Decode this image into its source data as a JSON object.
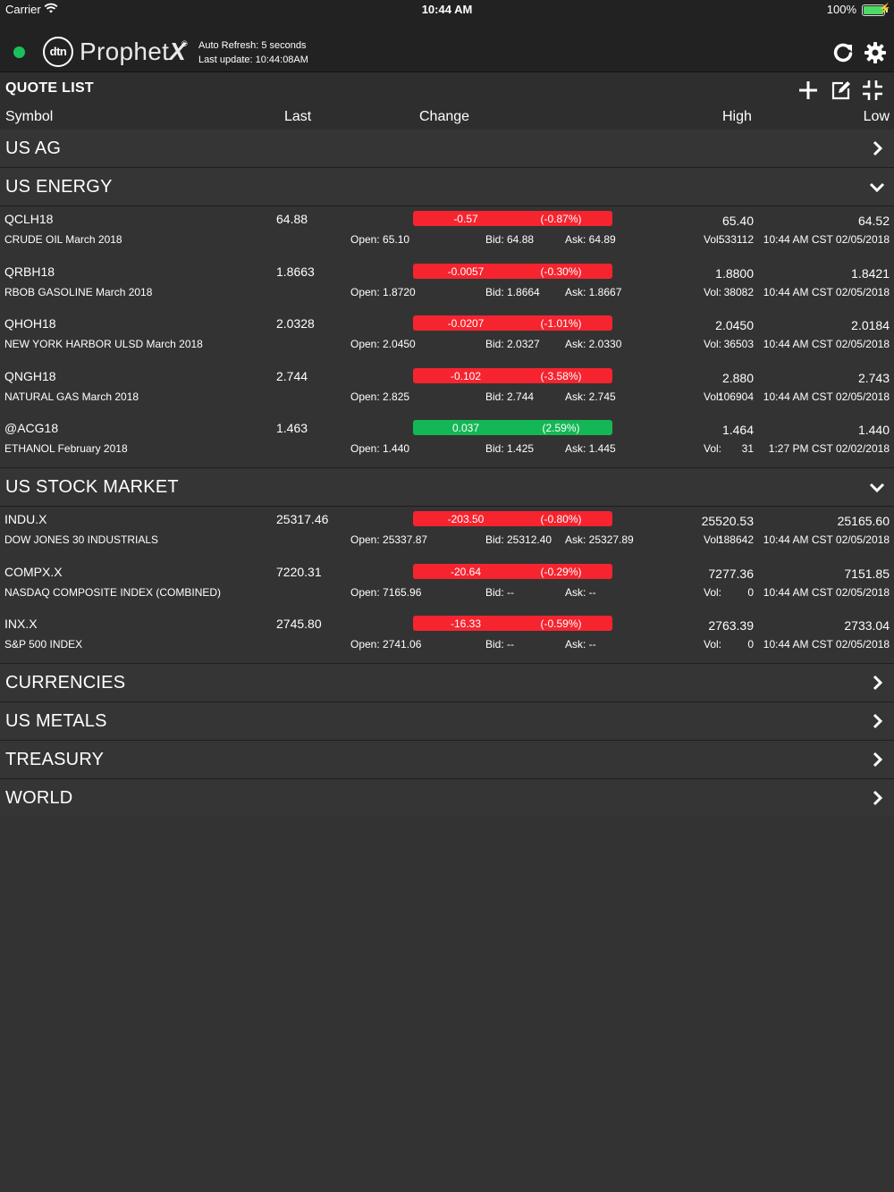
{
  "status_bar": {
    "carrier": "Carrier",
    "time": "10:44 AM",
    "battery": "100%"
  },
  "header": {
    "logo_mark": "dtn",
    "logo_word": "Prophet",
    "logo_x": "X",
    "logo_reg": "®",
    "auto_refresh": "Auto Refresh: 5 seconds",
    "last_update": "Last update: 10:44:08AM",
    "status_color": "#19c15a"
  },
  "quote_list": {
    "title": "QUOTE LIST",
    "columns": {
      "symbol": "Symbol",
      "last": "Last",
      "change": "Change",
      "high": "High",
      "low": "Low"
    }
  },
  "colors": {
    "negative": "#f5242f",
    "positive": "#14b755",
    "background": "#333333"
  },
  "groups": [
    {
      "name": "US AG",
      "expanded": false
    },
    {
      "name": "US ENERGY",
      "expanded": true
    },
    {
      "name": "US STOCK MARKET",
      "expanded": true
    },
    {
      "name": "CURRENCIES",
      "expanded": false
    },
    {
      "name": "US METALS",
      "expanded": false
    },
    {
      "name": "TREASURY",
      "expanded": false
    },
    {
      "name": "WORLD",
      "expanded": false
    }
  ],
  "energy_rows": [
    {
      "symbol": "QCLH18",
      "desc": "CRUDE OIL March 2018",
      "last": "64.88",
      "change": "-0.57",
      "pct": "(-0.87%)",
      "dir": "neg",
      "open": "Open: 65.10",
      "bid": "Bid: 64.88",
      "ask": "Ask: 64.89",
      "high": "65.40",
      "low": "64.52",
      "vol_label": "Vol:",
      "vol": "533112",
      "ts": "10:44 AM CST 02/05/2018"
    },
    {
      "symbol": "QRBH18",
      "desc": "RBOB GASOLINE March 2018",
      "last": "1.8663",
      "change": "-0.0057",
      "pct": "(-0.30%)",
      "dir": "neg",
      "open": "Open: 1.8720",
      "bid": "Bid: 1.8664",
      "ask": "Ask: 1.8667",
      "high": "1.8800",
      "low": "1.8421",
      "vol_label": "Vol:",
      "vol": "38082",
      "ts": "10:44 AM CST 02/05/2018"
    },
    {
      "symbol": "QHOH18",
      "desc": "NEW YORK HARBOR ULSD March 2018",
      "last": "2.0328",
      "change": "-0.0207",
      "pct": "(-1.01%)",
      "dir": "neg",
      "open": "Open: 2.0450",
      "bid": "Bid: 2.0327",
      "ask": "Ask: 2.0330",
      "high": "2.0450",
      "low": "2.0184",
      "vol_label": "Vol:",
      "vol": "36503",
      "ts": "10:44 AM CST 02/05/2018"
    },
    {
      "symbol": "QNGH18",
      "desc": "NATURAL GAS March 2018",
      "last": "2.744",
      "change": "-0.102",
      "pct": "(-3.58%)",
      "dir": "neg",
      "open": "Open: 2.825",
      "bid": "Bid: 2.744",
      "ask": "Ask: 2.745",
      "high": "2.880",
      "low": "2.743",
      "vol_label": "Vol:",
      "vol": "106904",
      "ts": "10:44 AM CST 02/05/2018"
    },
    {
      "symbol": "@ACG18",
      "desc": "ETHANOL February 2018",
      "last": "1.463",
      "change": "0.037",
      "pct": "(2.59%)",
      "dir": "pos",
      "open": "Open: 1.440",
      "bid": "Bid: 1.425",
      "ask": "Ask: 1.445",
      "high": "1.464",
      "low": "1.440",
      "vol_label": "Vol:",
      "vol": "31",
      "ts": "1:27 PM CST 02/02/2018"
    }
  ],
  "stock_rows": [
    {
      "symbol": "INDU.X",
      "desc": "DOW JONES 30 INDUSTRIALS",
      "last": "25317.46",
      "change": "-203.50",
      "pct": "(-0.80%)",
      "dir": "neg",
      "open": "Open: 25337.87",
      "bid": "Bid: 25312.40",
      "ask": "Ask: 25327.89",
      "high": "25520.53",
      "low": "25165.60",
      "vol_label": "Vol:",
      "vol": "188642",
      "ts": "10:44 AM CST 02/05/2018"
    },
    {
      "symbol": "COMPX.X",
      "desc": "NASDAQ COMPOSITE INDEX (COMBINED)",
      "last": "7220.31",
      "change": "-20.64",
      "pct": "(-0.29%)",
      "dir": "neg",
      "open": "Open: 7165.96",
      "bid": "Bid: --",
      "ask": "Ask: --",
      "high": "7277.36",
      "low": "7151.85",
      "vol_label": "Vol:",
      "vol": "0",
      "ts": "10:44 AM CST 02/05/2018"
    },
    {
      "symbol": "INX.X",
      "desc": "S&P 500 INDEX",
      "last": "2745.80",
      "change": "-16.33",
      "pct": "(-0.59%)",
      "dir": "neg",
      "open": "Open: 2741.06",
      "bid": "Bid: --",
      "ask": "Ask: --",
      "high": "2763.39",
      "low": "2733.04",
      "vol_label": "Vol:",
      "vol": "0",
      "ts": "10:44 AM CST 02/05/2018"
    }
  ]
}
